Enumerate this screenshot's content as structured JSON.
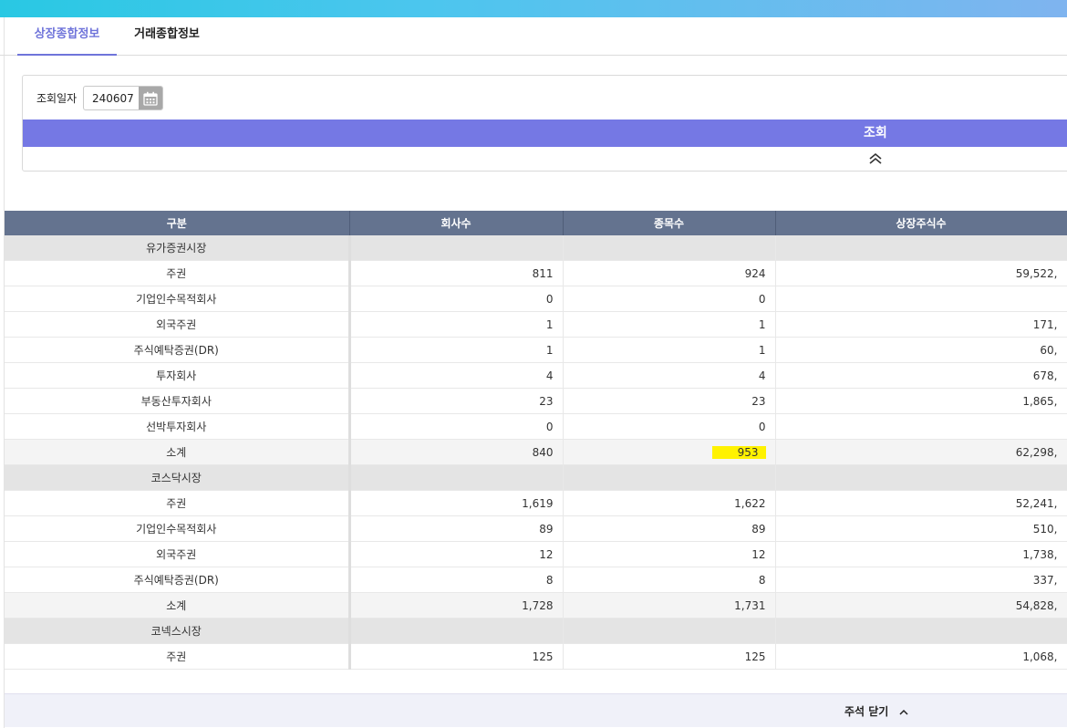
{
  "tabs": [
    {
      "label": "상장종합정보",
      "active": true
    },
    {
      "label": "거래종합정보",
      "active": false
    }
  ],
  "search": {
    "date_label": "조회일자",
    "date_value": "240607",
    "search_button": "조회"
  },
  "table": {
    "headers": [
      "구분",
      "회사수",
      "종목수",
      "상장주식수"
    ],
    "rows": [
      {
        "type": "section",
        "label": "유가증권시장",
        "values": [
          "",
          "",
          ""
        ]
      },
      {
        "type": "item",
        "label": "주권",
        "values": [
          "811",
          "924",
          "59,522,"
        ]
      },
      {
        "type": "item",
        "label": "기업인수목적회사",
        "values": [
          "0",
          "0",
          ""
        ]
      },
      {
        "type": "item",
        "label": "외국주권",
        "values": [
          "1",
          "1",
          "171,"
        ]
      },
      {
        "type": "item",
        "label": "주식예탁증권(DR)",
        "values": [
          "1",
          "1",
          "60,"
        ]
      },
      {
        "type": "item",
        "label": "투자회사",
        "values": [
          "4",
          "4",
          "678,"
        ]
      },
      {
        "type": "item",
        "label": "부동산투자회사",
        "values": [
          "23",
          "23",
          "1,865,"
        ]
      },
      {
        "type": "item",
        "label": "선박투자회사",
        "values": [
          "0",
          "0",
          ""
        ]
      },
      {
        "type": "subtotal",
        "label": "소계",
        "values": [
          "840",
          "953",
          "62,298,"
        ],
        "highlight_col": 1
      },
      {
        "type": "section",
        "label": "코스닥시장",
        "values": [
          "",
          "",
          ""
        ]
      },
      {
        "type": "item",
        "label": "주권",
        "values": [
          "1,619",
          "1,622",
          "52,241,"
        ]
      },
      {
        "type": "item",
        "label": "기업인수목적회사",
        "values": [
          "89",
          "89",
          "510,"
        ]
      },
      {
        "type": "item",
        "label": "외국주권",
        "values": [
          "12",
          "12",
          "1,738,"
        ]
      },
      {
        "type": "item",
        "label": "주식예탁증권(DR)",
        "values": [
          "8",
          "8",
          "337,"
        ]
      },
      {
        "type": "subtotal",
        "label": "소계",
        "values": [
          "1,728",
          "1,731",
          "54,828,"
        ]
      },
      {
        "type": "section",
        "label": "코넥스시장",
        "values": [
          "",
          "",
          ""
        ]
      },
      {
        "type": "item",
        "label": "주권",
        "values": [
          "125",
          "125",
          "1,068,"
        ]
      }
    ]
  },
  "footer": {
    "toggle_label": "주석 닫기"
  },
  "colors": {
    "accent": "#6f74da",
    "search_bar": "#7578e4",
    "table_header": "#64738f",
    "highlight": "#fff200"
  }
}
